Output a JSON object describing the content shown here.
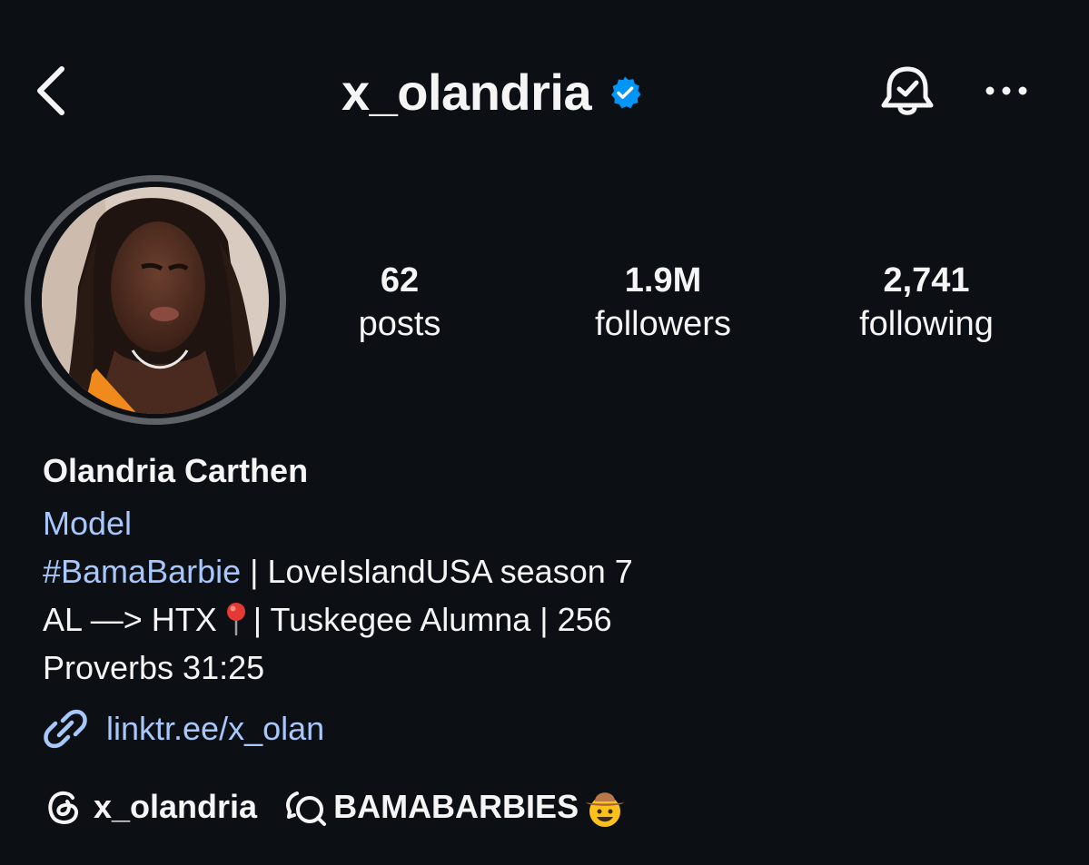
{
  "header": {
    "username": "x_olandria",
    "verified": true,
    "accent_color": "#0095f6"
  },
  "stats": {
    "posts": {
      "value": "62",
      "label": "posts"
    },
    "followers": {
      "value": "1.9M",
      "label": "followers"
    },
    "following": {
      "value": "2,741",
      "label": "following"
    }
  },
  "profile": {
    "full_name": "Olandria Carthen",
    "category": "Model",
    "bio": {
      "hashtag": "#BamaBarbie",
      "line1_rest": " | LoveIslandUSA season 7",
      "line2_start": "AL —> HTX",
      "line2_pin_icon": "round-pushpin-emoji",
      "line2_rest": "| Tuskegee Alumna | 256",
      "line3": "Proverbs 31:25"
    },
    "link": {
      "icon": "link-icon",
      "text": "linktr.ee/x_olan"
    },
    "threads": {
      "icon": "threads-icon",
      "handle": "x_olandria"
    },
    "channel": {
      "icon": "broadcast-channel-icon",
      "name": "BAMABARBIES",
      "emoji": "cowboy-hat-face-emoji"
    }
  },
  "colors": {
    "background": "#0c1014",
    "text": "#f5f5f5",
    "link": "#a8c7fa",
    "avatar_ring": "#5f6368"
  }
}
